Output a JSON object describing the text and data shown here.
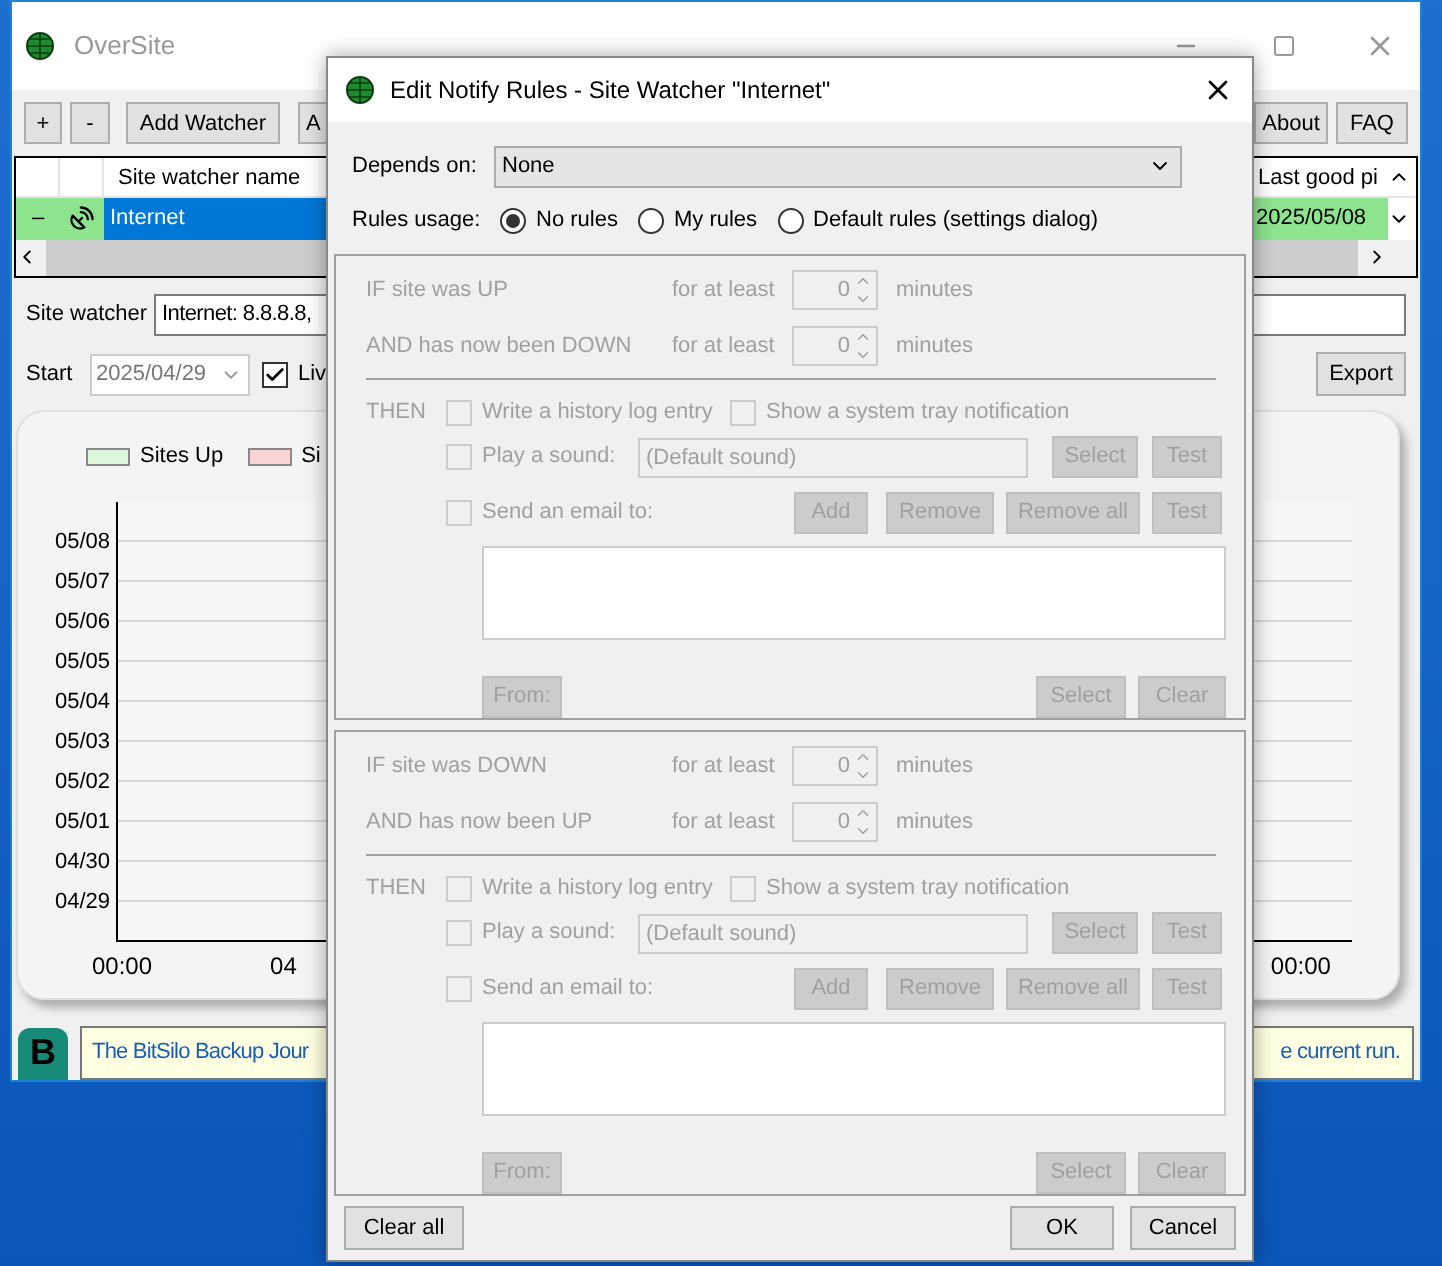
{
  "main_window": {
    "title": "OverSite",
    "toolbar": [
      "+",
      "-",
      "Add Watcher",
      "A"
    ],
    "toolbar_right": [
      "About",
      "FAQ"
    ],
    "table": {
      "columns": [
        "Site watcher name",
        "Last good pi"
      ],
      "rows": [
        {
          "status": "–",
          "up": true,
          "name": "Internet",
          "last_good": "2025/05/08",
          "selected": true
        }
      ]
    },
    "site_watcher": {
      "label": "Site watcher",
      "value": "Internet: 8.8.8.8,"
    },
    "start": {
      "label": "Start",
      "value": "2025/04/29"
    },
    "live": {
      "label": "Liv",
      "checked": true
    },
    "export": "Export",
    "chart": {
      "legend": [
        {
          "label": "Sites Up",
          "color": "#ddf7dd"
        },
        {
          "label": "Si",
          "color": "#f8d4d4"
        }
      ],
      "y_labels": [
        "05/08",
        "05/07",
        "05/06",
        "05/05",
        "05/04",
        "05/03",
        "05/02",
        "05/01",
        "04/30",
        "04/29"
      ],
      "x_labels": [
        "00:00",
        "04",
        "00:00"
      ]
    },
    "news": {
      "logo": "B",
      "left": "The BitSilo Backup Jour",
      "right": "e current run."
    }
  },
  "dialog": {
    "title": "Edit Notify Rules - Site Watcher \"Internet\"",
    "depends_on": {
      "label": "Depends on:",
      "value": "None"
    },
    "rules_usage": {
      "label": "Rules usage:",
      "options": [
        {
          "label": "No rules",
          "selected": true
        },
        {
          "label": "My rules",
          "selected": false
        },
        {
          "label": "Default rules (settings dialog)",
          "selected": false
        }
      ]
    },
    "rule_groups": [
      {
        "disabled": true,
        "conditions": [
          {
            "label": "IF site was UP",
            "for": "for at least",
            "value": "0",
            "unit": "minutes"
          },
          {
            "label": "AND has now been DOWN",
            "for": "for at least",
            "value": "0",
            "unit": "minutes"
          }
        ],
        "then": "THEN",
        "log": {
          "label": "Write a history log entry",
          "checked": false
        },
        "tray": {
          "label": "Show a system tray notification",
          "checked": false
        },
        "sound": {
          "label": "Play a sound:",
          "checked": false,
          "value": "(Default sound)",
          "buttons": [
            "Select",
            "Test"
          ]
        },
        "email": {
          "label": "Send an email to:",
          "checked": false,
          "buttons": [
            "Add",
            "Remove",
            "Remove all",
            "Test"
          ]
        },
        "from": "From:",
        "list_buttons": [
          "Select",
          "Clear"
        ]
      },
      {
        "disabled": true,
        "conditions": [
          {
            "label": "IF site was DOWN",
            "for": "for at least",
            "value": "0",
            "unit": "minutes"
          },
          {
            "label": "AND has now been UP",
            "for": "for at least",
            "value": "0",
            "unit": "minutes"
          }
        ],
        "then": "THEN",
        "log": {
          "label": "Write a history log entry",
          "checked": false
        },
        "tray": {
          "label": "Show a system tray notification",
          "checked": false
        },
        "sound": {
          "label": "Play a sound:",
          "checked": false,
          "value": "(Default sound)",
          "buttons": [
            "Select",
            "Test"
          ]
        },
        "email": {
          "label": "Send an email to:",
          "checked": false,
          "buttons": [
            "Add",
            "Remove",
            "Remove all",
            "Test"
          ]
        },
        "from": "From:",
        "list_buttons": [
          "Select",
          "Clear"
        ]
      }
    ],
    "footer": {
      "left": "Clear all",
      "right": [
        "OK",
        "Cancel"
      ]
    }
  }
}
